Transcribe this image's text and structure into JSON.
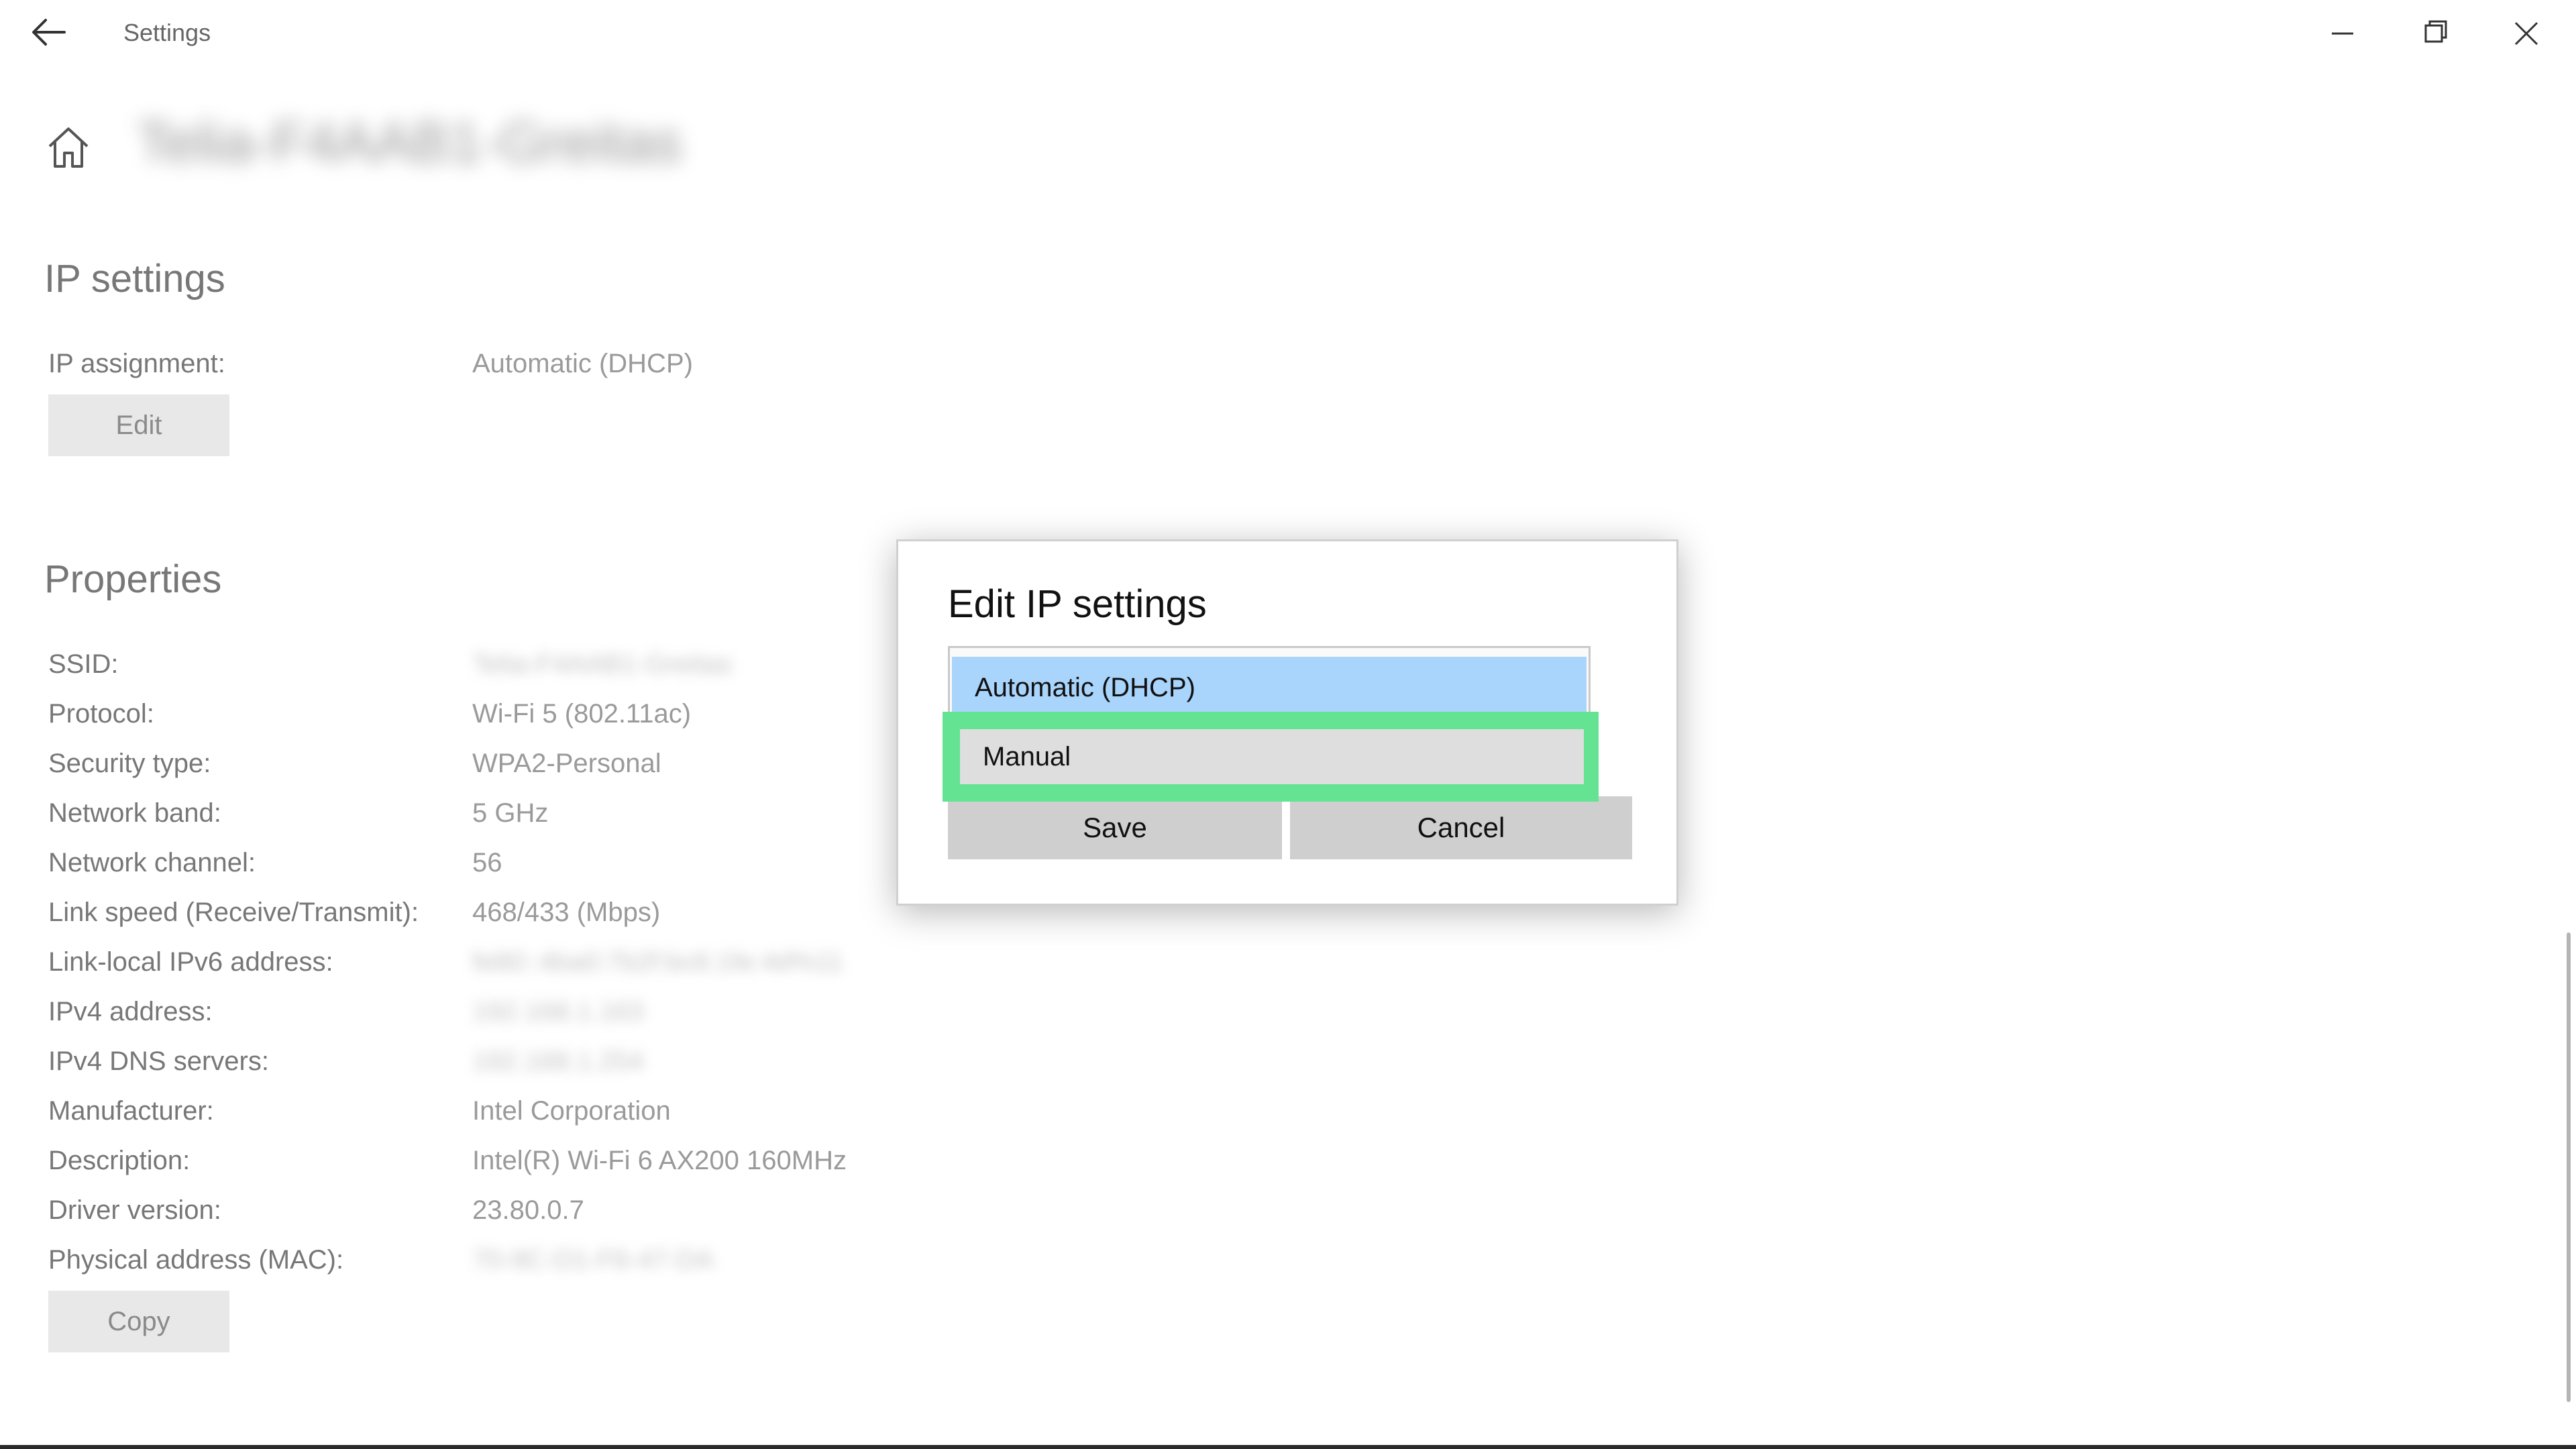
{
  "window": {
    "title": "Settings",
    "back_icon": "arrow-left-icon",
    "minimize_icon": "minimize-icon",
    "maximize_icon": "restore-icon",
    "close_icon": "close-icon"
  },
  "header": {
    "home_icon": "home-icon",
    "network_name": "Telia-F4AAB1-Greitas"
  },
  "ip_settings": {
    "title": "IP settings",
    "assignment_label": "IP assignment:",
    "assignment_value": "Automatic (DHCP)",
    "edit_label": "Edit"
  },
  "properties": {
    "title": "Properties",
    "rows": [
      {
        "label": "SSID:",
        "value": "Telia-F4AAB1-Greitas",
        "blurred": true
      },
      {
        "label": "Protocol:",
        "value": "Wi-Fi 5 (802.11ac)",
        "blurred": false
      },
      {
        "label": "Security type:",
        "value": "WPA2-Personal",
        "blurred": false
      },
      {
        "label": "Network band:",
        "value": "5 GHz",
        "blurred": false
      },
      {
        "label": "Network channel:",
        "value": "56",
        "blurred": false
      },
      {
        "label": "Link speed (Receive/Transmit):",
        "value": "468/433 (Mbps)",
        "blurred": false
      },
      {
        "label": "Link-local IPv6 address:",
        "value": "fe80::4ba0:7b2f:bc6:1fe:4d%11",
        "blurred": true
      },
      {
        "label": "IPv4 address:",
        "value": "192.168.1.163",
        "blurred": true
      },
      {
        "label": "IPv4 DNS servers:",
        "value": "192.168.1.254",
        "blurred": true
      },
      {
        "label": "Manufacturer:",
        "value": "Intel Corporation",
        "blurred": false
      },
      {
        "label": "Description:",
        "value": "Intel(R) Wi-Fi 6 AX200 160MHz",
        "blurred": false
      },
      {
        "label": "Driver version:",
        "value": "23.80.0.7",
        "blurred": false
      },
      {
        "label": "Physical address (MAC):",
        "value": "70-9C-D1-F6-47-DA",
        "blurred": true
      }
    ],
    "copy_label": "Copy"
  },
  "dialog": {
    "title": "Edit IP settings",
    "options": [
      "Automatic (DHCP)",
      "Manual"
    ],
    "hovered_option": "Manual",
    "save_label": "Save",
    "cancel_label": "Cancel",
    "highlight_color": "#64e392",
    "selected_color": "#a9d4fb"
  }
}
